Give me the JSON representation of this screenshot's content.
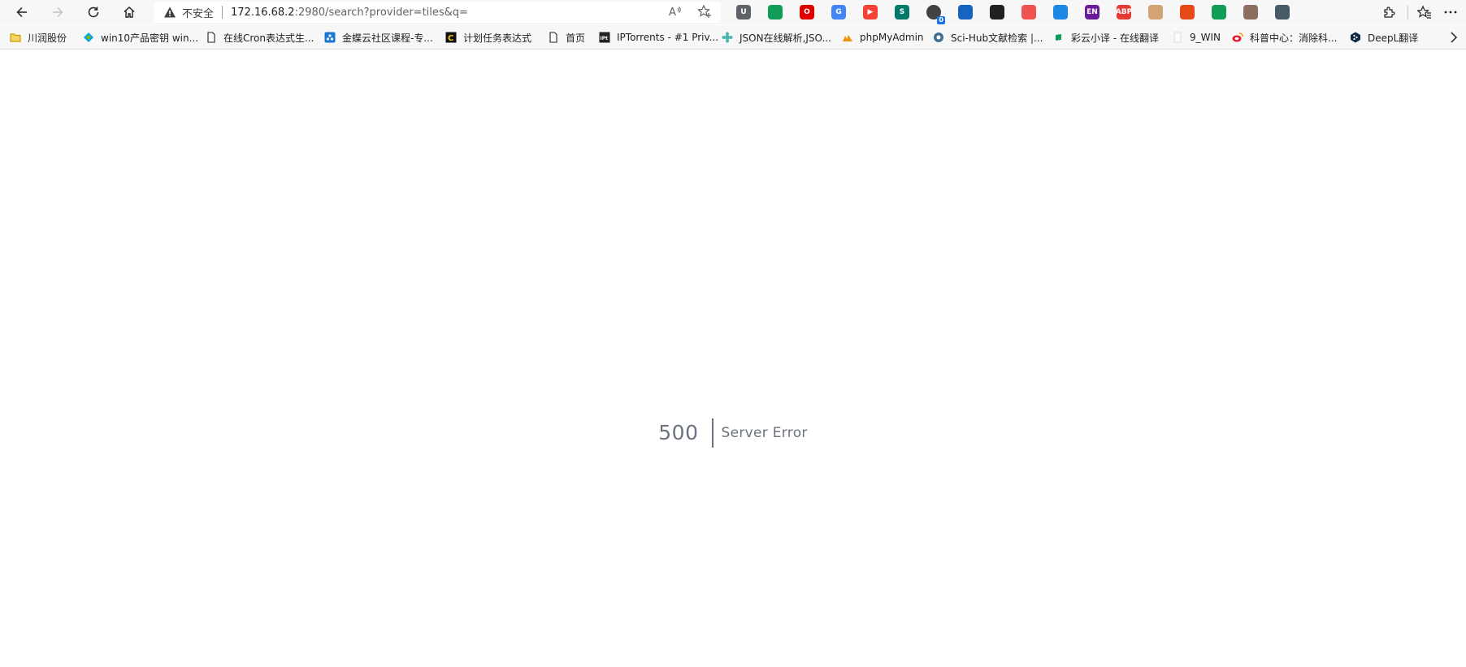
{
  "browser": {
    "security_label": "不安全",
    "url_host": "172.16.68.2",
    "url_rest": ":2980/search?provider=tiles&q=",
    "extension_badge": "0",
    "extensions": [
      {
        "name": "bitwarden-icon",
        "glyph": "U",
        "color": "#5f6368"
      },
      {
        "name": "green-flag-icon",
        "glyph": "",
        "color": "#0f9d58"
      },
      {
        "name": "opera-icon",
        "glyph": "O",
        "color": "#e00000"
      },
      {
        "name": "google-translate-icon",
        "glyph": "G",
        "color": "#4285f4"
      },
      {
        "name": "youtube-icon",
        "glyph": "▶",
        "color": "#f44336"
      },
      {
        "name": "s-extension-icon",
        "glyph": "S",
        "color": "#00796b"
      },
      {
        "name": "badge-extension-icon",
        "glyph": "",
        "color": "#424242"
      },
      {
        "name": "blue-square-icon",
        "glyph": "",
        "color": "#1565c0"
      },
      {
        "name": "mask-icon",
        "glyph": "",
        "color": "#212121"
      },
      {
        "name": "red-slash-icon",
        "glyph": "",
        "color": "#ef5350"
      },
      {
        "name": "blue-diamond-icon",
        "glyph": "",
        "color": "#1e88e5"
      },
      {
        "name": "en-extension-icon",
        "glyph": "EN",
        "color": "#6a1b9a"
      },
      {
        "name": "adblock-plus-icon",
        "glyph": "ABP",
        "color": "#e53935"
      },
      {
        "name": "face-extension-icon",
        "glyph": "",
        "color": "#d4a373"
      },
      {
        "name": "red-logo-icon",
        "glyph": "",
        "color": "#e64a19"
      },
      {
        "name": "green-flag-icon-2",
        "glyph": "",
        "color": "#0f9d58"
      },
      {
        "name": "image-extension-icon",
        "glyph": "",
        "color": "#8d6e63"
      },
      {
        "name": "globe-extension-icon",
        "glyph": "",
        "color": "#455a64"
      }
    ]
  },
  "bookmarks": [
    {
      "label": "川润股份",
      "icon": "folder-icon"
    },
    {
      "label": "win10产品密钥 win...",
      "icon": "diamond-favicon-icon"
    },
    {
      "label": "在线Cron表达式生...",
      "icon": "page-icon"
    },
    {
      "label": "金蝶云社区课程-专...",
      "icon": "kingdee-favicon-icon"
    },
    {
      "label": "计划任务表达式",
      "icon": "c-favicon-icon"
    },
    {
      "label": "首页",
      "icon": "page-icon"
    },
    {
      "label": "IPTorrents - #1 Priv...",
      "icon": "ipt-favicon-icon"
    },
    {
      "label": "JSON在线解析,JSO...",
      "icon": "json-favicon-icon"
    },
    {
      "label": "phpMyAdmin",
      "icon": "phpmyadmin-favicon-icon"
    },
    {
      "label": "Sci-Hub文献检索 |...",
      "icon": "scihub-favicon-icon"
    },
    {
      "label": "彩云小译 - 在线翻译",
      "icon": "caiyun-favicon-icon"
    },
    {
      "label": "9_WIN",
      "icon": "blank-page-icon"
    },
    {
      "label": "科普中心：消除科...",
      "icon": "weibo-favicon-icon"
    },
    {
      "label": "DeepL翻译",
      "icon": "deepl-favicon-icon"
    }
  ],
  "error": {
    "code": "500",
    "message": "Server Error"
  }
}
